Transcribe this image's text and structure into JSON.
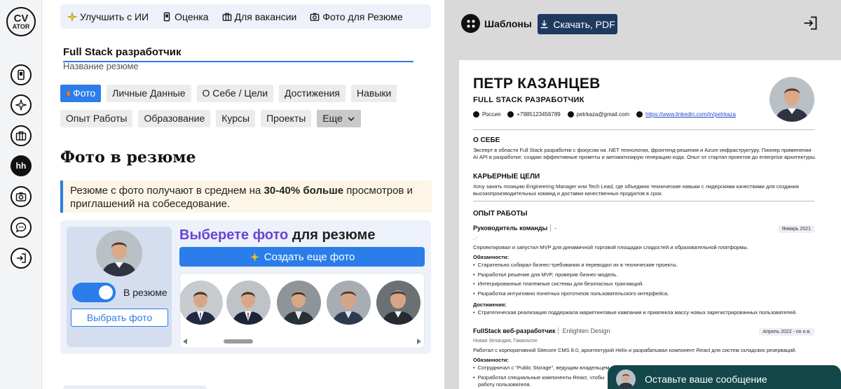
{
  "logo": {
    "line1": "CV",
    "line2": "ATOR"
  },
  "rail": {
    "hh_label": "hh"
  },
  "top_tabs": [
    {
      "label": "Улучшить с ИИ",
      "icon": "sparkle-icon"
    },
    {
      "label": "Оценка",
      "icon": "phone-icon"
    },
    {
      "label": "Для вакансии",
      "icon": "briefcase-icon"
    },
    {
      "label": "Фото для Резюме",
      "icon": "camera-icon"
    }
  ],
  "resume_title": {
    "value": "Full Stack разработчик",
    "hint": "Название резюме"
  },
  "section_tabs": {
    "row1": [
      "Фото",
      "Личные Данные",
      "О Себе / Цели",
      "Достижения",
      "Навыки"
    ],
    "row2": [
      "Опыт Работы",
      "Образование",
      "Курсы",
      "Проекты"
    ],
    "more": "Еще",
    "active": "Фото"
  },
  "photo_section": {
    "heading": "Фото в резюме",
    "notice_pre": "Резюме с фото получают в среднем на ",
    "notice_bold": "30-40% больше",
    "notice_post": " просмотров и приглашений на собеседование.",
    "toggle_label": "В резюме",
    "toggle_on": true,
    "choose_button": "Выбрать фото",
    "pick_title_w1": "Выберете",
    "pick_title_w2": "фото",
    "pick_title_w3": "для резюме",
    "generate_button": "Создать еще фото",
    "gallery_count": 5
  },
  "preview_toolbar": {
    "templates": "Шаблоны",
    "download": "Скачать, PDF"
  },
  "resume": {
    "name": "ПЕТР КАЗАНЦЕВ",
    "role": "FULL STACK РАЗРАБОТЧИК",
    "country": "Россия",
    "phone": "+7985123456789",
    "email": "petrkaza@gmail.com",
    "linkedin": "https://www.linkedin.com/in/petrkaza",
    "about_title": "О СЕБЕ",
    "about_text": "Эксперт в области Full Stack разработки с фокусом на .NET технологии, фронтенд-решения и Azure инфраструктуру. Пионер применения AI API в разработке: создаю эффективные промпты и автоматизирую генерацию кода. Опыт от стартап проектов до enterprise архитектуры.",
    "goals_title": "КАРЬЕРНЫЕ ЦЕЛИ",
    "goals_text": "Хочу занять позицию Engineering Manager или Tech Lead, где объединю технические навыки с лидерскими качествами для создания высокопроизводительных команд и доставки качественных продуктов в срок.",
    "exp_title": "ОПЫТ РАБОТЫ",
    "job1": {
      "title": "Руководитель команды",
      "company": "-",
      "date": "Январь 2021",
      "loc": ", -",
      "summary": "Спроектировал и запустил MVP для динамичной торговой площадки сладостей и образовательной платформы.",
      "duties_label": "Обязанности:",
      "duties": [
        "Старательно собирал бизнес-требования и переводил их в технические проекты.",
        "Разработал решение для MVP, проверив бизнес-модель.",
        "Интегрированные платежные системы для безопасных транзакций.",
        "Разработка интуитивно понятных прототипов пользовательского интерфейса."
      ],
      "ach_label": "Достижения:",
      "achievements": [
        "Стратегическая реализация поддержала маркетинговые кампании и привлекла массу новых зарегистрированных пользователей."
      ]
    },
    "job2": {
      "title": "FullStack веб-разработчик",
      "company": "Enlighten Design",
      "date": "Апрель 2022 - по н.в.",
      "loc": "Новая Зеландия, Гамильтон",
      "summary": "Работал с корпоративной Sitecore CMS 8.0, архитектурой Helix и разрабатывал компонент React для систем складских резерваций.",
      "duties_label": "Обязанности:",
      "duties": [
        "Сотрудничал с \"Public Storage\", ведущим владельцем",
        "Разработал специальные компоненты React, чтобы"
      ],
      "duty_cont": "работу пользователя."
    }
  },
  "chat": {
    "label": "Оставьте ваше сообщение"
  },
  "colors": {
    "accent": "#2b7de9",
    "dark_button": "#1e3a5f",
    "chat_bg": "#13474a",
    "purple": "#6a44d4"
  }
}
